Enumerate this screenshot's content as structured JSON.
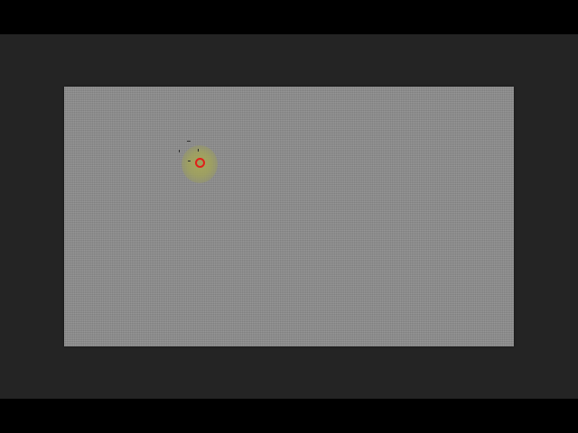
{
  "window": {
    "background": "#242424",
    "letterbox_color": "#000000"
  },
  "canvas": {
    "color": "#8c8c8c",
    "texture": "fine-noise"
  },
  "cursor": {
    "icon": "brush-target-icon",
    "ring_color": "#e0201a",
    "glow_color": "#a8a85a"
  }
}
